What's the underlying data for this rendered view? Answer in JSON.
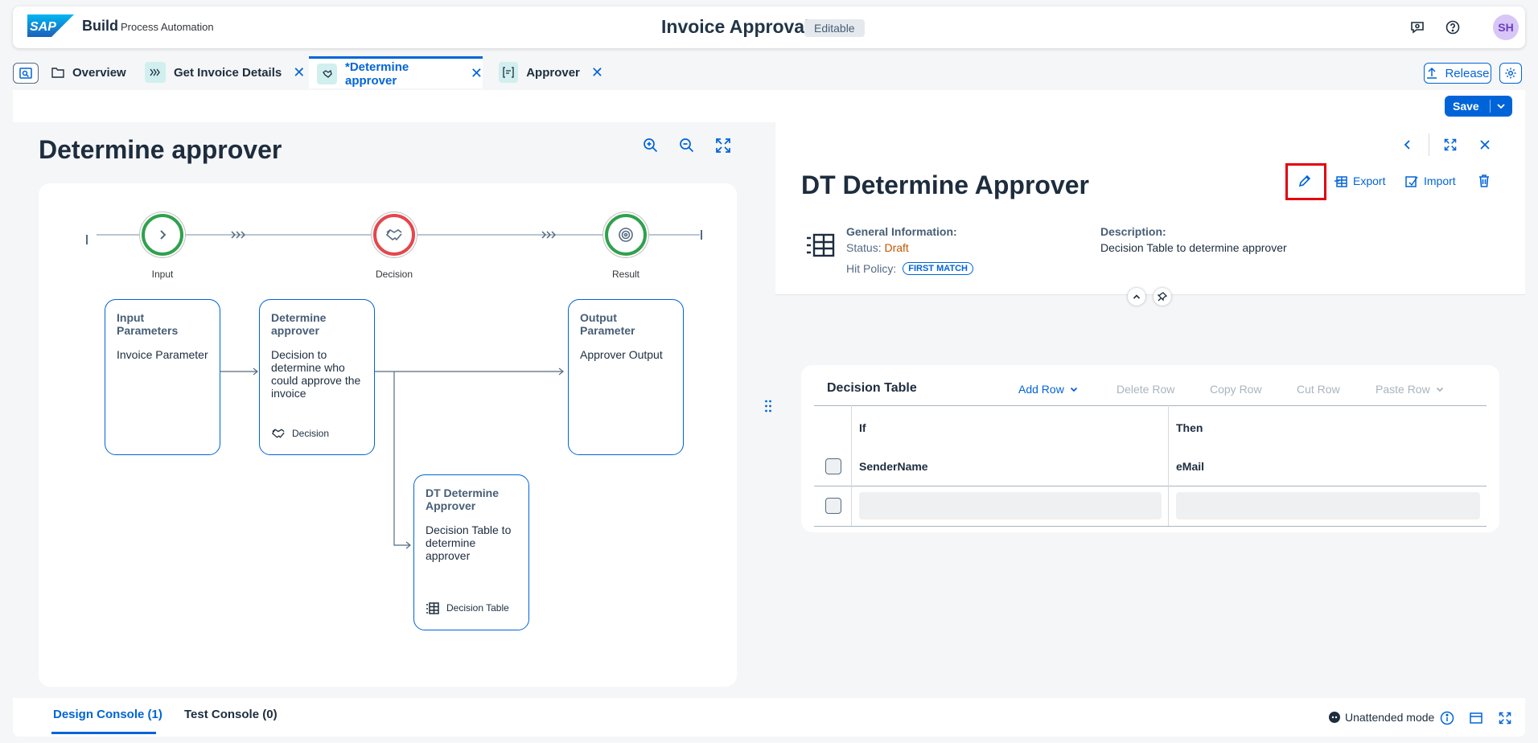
{
  "shell": {
    "brand": "Build",
    "product": "Process Automation",
    "title": "Invoice Approval",
    "status_badge": "Editable",
    "avatar_initials": "SH"
  },
  "tabs": [
    {
      "label": "Overview"
    },
    {
      "label": "Get Invoice Details"
    },
    {
      "label": "*Determine approver"
    },
    {
      "label": "Approver"
    }
  ],
  "tab_actions": {
    "release": "Release"
  },
  "toolbar": {
    "save": "Save"
  },
  "left_pane": {
    "title": "Determine approver",
    "flow_nodes": [
      {
        "label": "Input"
      },
      {
        "label": "Decision"
      },
      {
        "label": "Result"
      }
    ],
    "cards": {
      "input": {
        "title": "Input Parameters",
        "desc": "Invoice Parameter"
      },
      "decision": {
        "title": "Determine approver",
        "desc": "Decision to determine who could approve the invoice",
        "footer": "Decision"
      },
      "output": {
        "title": "Output Parameter",
        "desc": "Approver Output"
      },
      "dt": {
        "title": "DT Determine Approver",
        "desc": "Decision Table to determine approver",
        "footer": "Decision Table"
      }
    }
  },
  "right_pane": {
    "title": "DT Determine Approver",
    "actions": {
      "export": "Export",
      "import": "Import"
    },
    "general_info": {
      "label": "General Information:",
      "status_label": "Status:",
      "status_value": "Draft",
      "hit_policy_label": "Hit Policy:",
      "hit_policy_value": "FIRST MATCH"
    },
    "description": {
      "label": "Description:",
      "value": "Decision Table to determine approver"
    },
    "decision_table": {
      "title": "Decision Table",
      "buttons": {
        "add_row": "Add Row",
        "delete_row": "Delete Row",
        "copy_row": "Copy Row",
        "cut_row": "Cut Row",
        "paste_row": "Paste Row"
      },
      "if_header": "If",
      "then_header": "Then",
      "if_column": "SenderName",
      "then_column": "eMail"
    }
  },
  "console": {
    "design_tab": "Design Console (1)",
    "test_tab": "Test Console (0)",
    "mode": "Unattended mode"
  },
  "colors": {
    "accent": "#0064d9",
    "input_node": "#30a14e",
    "decision_node": "#e5464c",
    "status_draft": "#c35500",
    "highlight": "#e3000f"
  }
}
